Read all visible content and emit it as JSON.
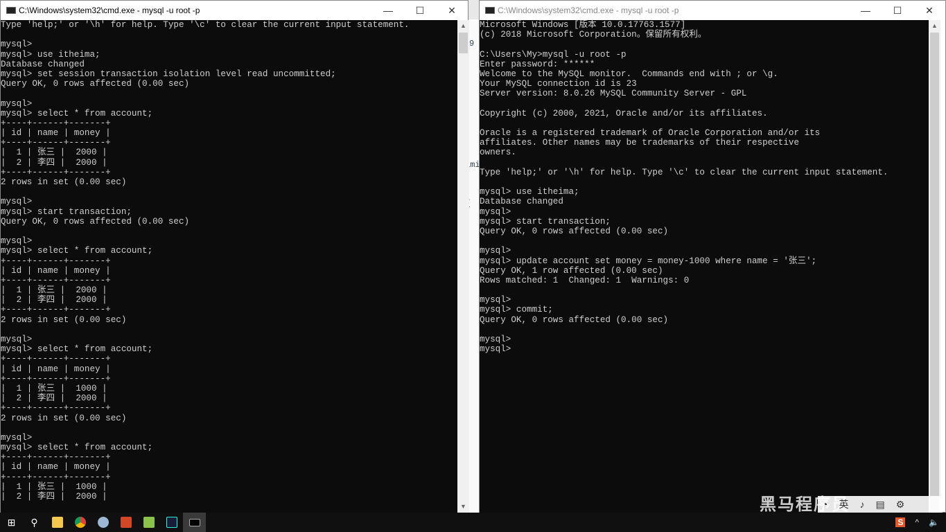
{
  "left_window": {
    "title": "C:\\Windows\\system32\\cmd.exe - mysql  -u root -p",
    "lines": [
      "Type 'help;' or '\\h' for help. Type '\\c' to clear the current input statement.",
      "",
      "mysql>",
      "mysql> use itheima;",
      "Database changed",
      "mysql> set session transaction isolation level read uncommitted;",
      "Query OK, 0 rows affected (0.00 sec)",
      "",
      "mysql>",
      "mysql> select * from account;",
      "+----+------+-------+",
      "| id | name | money |",
      "+----+------+-------+",
      "|  1 | 张三 |  2000 |",
      "|  2 | 李四 |  2000 |",
      "+----+------+-------+",
      "2 rows in set (0.00 sec)",
      "",
      "mysql>",
      "mysql> start transaction;",
      "Query OK, 0 rows affected (0.00 sec)",
      "",
      "mysql>",
      "mysql> select * from account;",
      "+----+------+-------+",
      "| id | name | money |",
      "+----+------+-------+",
      "|  1 | 张三 |  2000 |",
      "|  2 | 李四 |  2000 |",
      "+----+------+-------+",
      "2 rows in set (0.00 sec)",
      "",
      "mysql>",
      "mysql> select * from account;",
      "+----+------+-------+",
      "| id | name | money |",
      "+----+------+-------+",
      "|  1 | 张三 |  1000 |",
      "|  2 | 李四 |  2000 |",
      "+----+------+-------+",
      "2 rows in set (0.00 sec)",
      "",
      "mysql>",
      "mysql> select * from account;",
      "+----+------+-------+",
      "| id | name | money |",
      "+----+------+-------+",
      "|  1 | 张三 |  1000 |",
      "|  2 | 李四 |  2000 |"
    ]
  },
  "right_window": {
    "title": "C:\\Windows\\system32\\cmd.exe - mysql  -u root -p",
    "lines": [
      "Microsoft Windows [版本 10.0.17763.1577]",
      "(c) 2018 Microsoft Corporation。保留所有权利。",
      "",
      "C:\\Users\\My>mysql -u root -p",
      "Enter password: ******",
      "Welcome to the MySQL monitor.  Commands end with ; or \\g.",
      "Your MySQL connection id is 23",
      "Server version: 8.0.26 MySQL Community Server - GPL",
      "",
      "Copyright (c) 2000, 2021, Oracle and/or its affiliates.",
      "",
      "Oracle is a registered trademark of Oracle Corporation and/or its",
      "affiliates. Other names may be trademarks of their respective",
      "owners.",
      "",
      "Type 'help;' or '\\h' for help. Type '\\c' to clear the current input statement.",
      "",
      "mysql> use itheima;",
      "Database changed",
      "mysql>",
      "mysql> start transaction;",
      "Query OK, 0 rows affected (0.00 sec)",
      "",
      "mysql>",
      "mysql> update account set money = money-1000 where name = '张三';",
      "Query OK, 1 row affected (0.00 sec)",
      "Rows matched: 1  Changed: 1  Warnings: 0",
      "",
      "mysql>",
      "mysql> commit;",
      "Query OK, 0 rows affected (0.00 sec)",
      "",
      "mysql>",
      "mysql>"
    ]
  },
  "window_controls": {
    "minimize": "—",
    "maximize": "☐",
    "close": "✕"
  },
  "background_strip": {
    "fragments": [
      "9",
      "ami",
      "e T"
    ]
  },
  "watermark": "黑马程序员",
  "ime": {
    "mode": "英"
  },
  "taskbar": {
    "items": [
      "start",
      "search",
      "file-explorer",
      "chrome",
      "paint",
      "powerpoint",
      "notepad",
      "datagrip",
      "cmd"
    ]
  }
}
